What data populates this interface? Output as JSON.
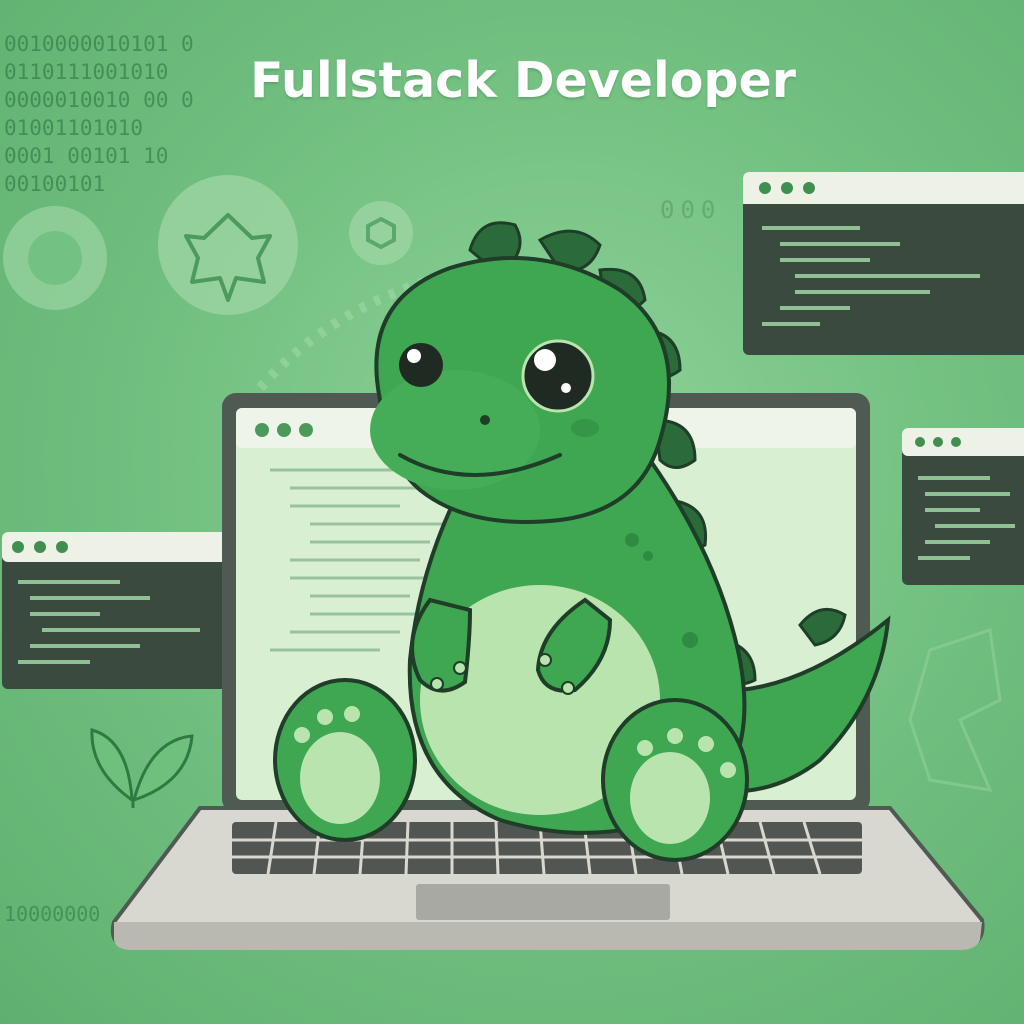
{
  "title": "Fullstack Developer",
  "binary_top": [
    "0010000010101 0",
    "0110111001010",
    "0000010010 00 0",
    "01001101010",
    "0001 00101 10",
    "00100101"
  ],
  "binary_bottom": "10000000",
  "dots": "000",
  "icons": {
    "mascot": "dinosaur-icon",
    "laptop": "laptop-icon",
    "leaf": "leaf-icon",
    "bug": "bug-icon",
    "hex": "hexagon-icon"
  },
  "colors": {
    "background": "#75c283",
    "dino": "#3fa652",
    "dino_belly": "#b9e4ae",
    "dino_dark": "#2b6b3a",
    "laptop_body": "#d8d8d0",
    "window_dark": "#3b4a3f"
  }
}
